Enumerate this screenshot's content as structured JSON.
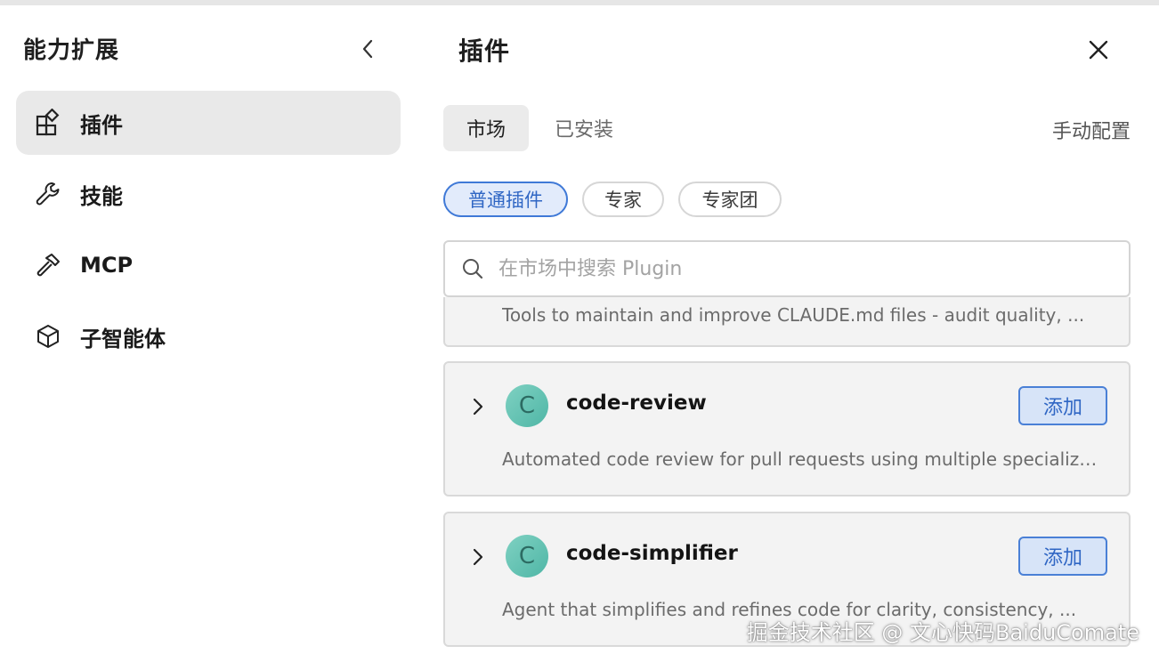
{
  "sidebar": {
    "title": "能力扩展",
    "items": [
      {
        "label": "插件",
        "icon": "plugin-grid-icon"
      },
      {
        "label": "技能",
        "icon": "wrench-icon"
      },
      {
        "label": "MCP",
        "icon": "hammer-icon"
      },
      {
        "label": "子智能体",
        "icon": "cube-icon"
      }
    ]
  },
  "main": {
    "title": "插件",
    "tabs": [
      {
        "label": "市场"
      },
      {
        "label": "已安装"
      }
    ],
    "manual_config": "手动配置",
    "filters": [
      {
        "label": "普通插件"
      },
      {
        "label": "专家"
      },
      {
        "label": "专家团"
      }
    ],
    "search": {
      "placeholder": "在市场中搜索 Plugin"
    },
    "plugins": [
      {
        "name": "",
        "avatar": "",
        "description": "Tools to maintain and improve CLAUDE.md files - audit quality, ..."
      },
      {
        "name": "code-review",
        "avatar": "C",
        "description": "Automated code review for pull requests using multiple specialized agents",
        "add_label": "添加"
      },
      {
        "name": "code-simplifier",
        "avatar": "C",
        "description": "Agent that simplifies and refines code for clarity, consistency, ...",
        "add_label": "添加"
      }
    ]
  },
  "watermark": "掘金技术社区 @ 文心快码BaiduComate",
  "colors": {
    "accent": "#2f66c4",
    "accent_bg": "#d7e4f8",
    "active_bg": "#e9e9e9",
    "avatar": "#5cbfae"
  }
}
